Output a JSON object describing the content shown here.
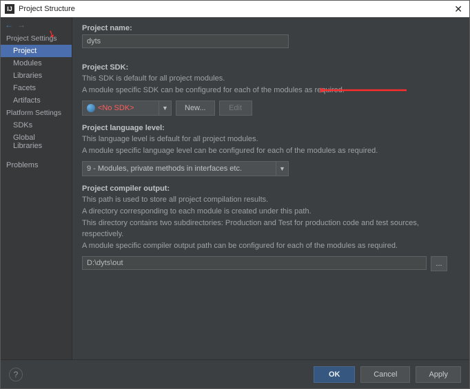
{
  "window": {
    "title": "Project Structure"
  },
  "sidebar": {
    "groups": [
      {
        "header": "Project Settings",
        "items": [
          {
            "label": "Project",
            "selected": true
          },
          {
            "label": "Modules"
          },
          {
            "label": "Libraries"
          },
          {
            "label": "Facets"
          },
          {
            "label": "Artifacts"
          }
        ]
      },
      {
        "header": "Platform Settings",
        "items": [
          {
            "label": "SDKs"
          },
          {
            "label": "Global Libraries"
          }
        ]
      },
      {
        "header": "",
        "items": [
          {
            "label": "Problems"
          }
        ]
      }
    ]
  },
  "content": {
    "projectName": {
      "label": "Project name:",
      "value": "dyts"
    },
    "sdk": {
      "label": "Project SDK:",
      "desc1": "This SDK is default for all project modules.",
      "desc2": "A module specific SDK can be configured for each of the modules as required.",
      "selected": "<No SDK>",
      "btnNew": "New...",
      "btnEdit": "Edit"
    },
    "lang": {
      "label": "Project language level:",
      "desc1": "This language level is default for all project modules.",
      "desc2": "A module specific language level can be configured for each of the modules as required.",
      "selected": "9 - Modules, private methods in interfaces etc."
    },
    "output": {
      "label": "Project compiler output:",
      "desc1": "This path is used to store all project compilation results.",
      "desc2": "A directory corresponding to each module is created under this path.",
      "desc3": "This directory contains two subdirectories: Production and Test for production code and test sources, respectively.",
      "desc4": "A module specific compiler output path can be configured for each of the modules as required.",
      "value": "D:\\dyts\\out",
      "browse": "..."
    }
  },
  "footer": {
    "help": "?",
    "ok": "OK",
    "cancel": "Cancel",
    "apply": "Apply"
  }
}
